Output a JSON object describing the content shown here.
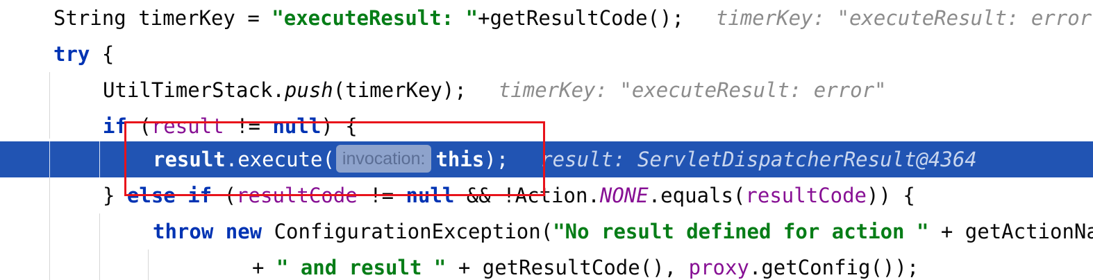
{
  "lines": [
    {
      "id": "timer-key",
      "t1": "String timerKey = ",
      "str1": "\"executeResult: \"",
      "t2": "+getResultCode();",
      "hint": "timerKey: \"executeResult: error\""
    },
    {
      "id": "try",
      "kw": "try",
      "t1": " {"
    },
    {
      "id": "push",
      "t1": "UtilTimerStack.",
      "ital": "push",
      "t2": "(timerKey);",
      "hint": "timerKey: \"executeResult: error\""
    },
    {
      "id": "if",
      "kw": "if",
      "t1": " (",
      "fld": "result",
      "t2": " != ",
      "kw2": "null",
      "t3": ") {"
    },
    {
      "id": "execute",
      "fld": "result",
      "t1": ".execute(",
      "param": "invocation:",
      "kw": "this",
      "t2": ");",
      "hint": "result: ServletDispatcherResult@4364"
    },
    {
      "id": "else-if",
      "t1": "} ",
      "kw": "else if",
      "t2": " (",
      "fld": "resultCode",
      "t3": " != ",
      "kw2": "null",
      "t4": " && !Action.",
      "fld_ital": "NONE",
      "t5": ".equals(",
      "fld2": "resultCode",
      "t6": ")) {"
    },
    {
      "id": "throw",
      "kw": "throw new",
      "t1": " ConfigurationException(",
      "str1": "\"No result defined for action \"",
      "t2": " + getActionName()"
    },
    {
      "id": "and-result",
      "t1": "+ ",
      "str1": "\" and result \"",
      "t2": " + getResultCode(), ",
      "fld": "proxy",
      "t3": ".getConfig());"
    }
  ]
}
